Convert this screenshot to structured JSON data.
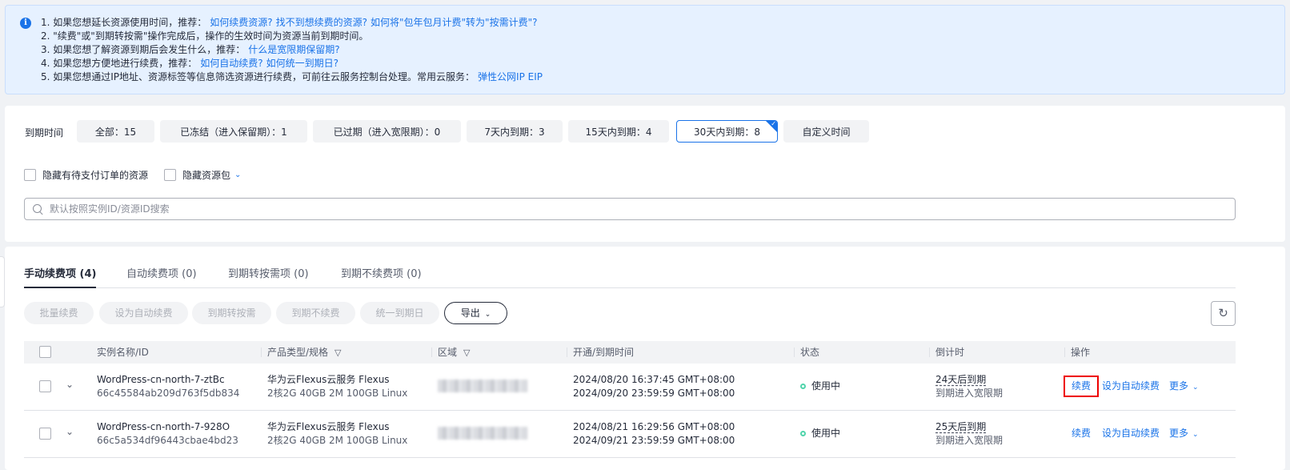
{
  "notice": {
    "icon": "info-icon",
    "lines": [
      {
        "text": "1. 如果您想延长资源使用时间，推荐：",
        "links": [
          "如何续费资源?",
          "找不到想续费的资源?",
          "如何将\"包年包月计费\"转为\"按需计费\"?"
        ]
      },
      {
        "text": "2. \"续费\"或\"到期转按需\"操作完成后，操作的生效时间为资源当前到期时间。",
        "links": []
      },
      {
        "text": "3. 如果您想了解资源到期后会发生什么，推荐：",
        "links": [
          "什么是宽限期保留期?"
        ]
      },
      {
        "text": "4. 如果您想方便地进行续费，推荐：",
        "links": [
          "如何自动续费?",
          "如何统一到期日?"
        ]
      },
      {
        "text": "5. 如果您想通过IP地址、资源标签等信息筛选资源进行续费，可前往云服务控制台处理。常用云服务：",
        "links": [
          "弹性公网IP EIP"
        ]
      }
    ]
  },
  "filter": {
    "expire_label": "到期时间",
    "chips": [
      "全部：15",
      "已冻结（进入保留期）：1",
      "已过期（进入宽限期）：0",
      "7天内到期：3",
      "15天内到期：4",
      "30天内到期：8",
      "自定义时间"
    ],
    "active_chip": "30天内到期：8",
    "hide_pending_label": "隐藏有待支付订单的资源",
    "hide_package_label": "隐藏资源包",
    "search_placeholder": "默认按照实例ID/资源ID搜索"
  },
  "tabs": [
    "手动续费项 (4)",
    "自动续费项 (0)",
    "到期转按需项 (0)",
    "到期不续费项 (0)"
  ],
  "active_tab": "手动续费项 (4)",
  "actions": {
    "batch_renew": "批量续费",
    "set_auto_renew": "设为自动续费",
    "to_on_demand": "到期转按需",
    "no_renew": "到期不续费",
    "unify_expiry": "统一到期日",
    "export": "导出"
  },
  "table": {
    "columns": {
      "name": "实例名称/ID",
      "product": "产品类型/规格",
      "region": "区域",
      "time": "开通/到期时间",
      "status": "状态",
      "countdown": "倒计时",
      "ops": "操作"
    },
    "rows": [
      {
        "name": "WordPress-cn-north-7-ztBc",
        "id": "66c45584ab209d763f5db834",
        "product": "华为云Flexus云服务 Flexus",
        "spec": "2核2G 40GB 2M 100GB Linux",
        "start": "2024/08/20 16:37:45 GMT+08:00",
        "end": "2024/09/20 23:59:59 GMT+08:00",
        "status": "使用中",
        "countdown": "24天后到期",
        "countdown_note": "到期进入宽限期",
        "op_renew": "续费",
        "op_auto": "设为自动续费",
        "op_more": "更多"
      },
      {
        "name": "WordPress-cn-north-7-928O",
        "id": "66c5a534df96443cbae4bd23",
        "product": "华为云Flexus云服务 Flexus",
        "spec": "2核2G 40GB 2M 100GB Linux",
        "start": "2024/08/21 16:29:56 GMT+08:00",
        "end": "2024/09/21 23:59:59 GMT+08:00",
        "status": "使用中",
        "countdown": "25天后到期",
        "countdown_note": "到期进入宽限期",
        "op_renew": "续费",
        "op_auto": "设为自动续费",
        "op_more": "更多"
      }
    ]
  },
  "colors": {
    "accent": "#1a73e8",
    "notice_bg": "#e6f1ff",
    "status_dot": "#50d4ab",
    "highlight_box": "#ee0000"
  }
}
